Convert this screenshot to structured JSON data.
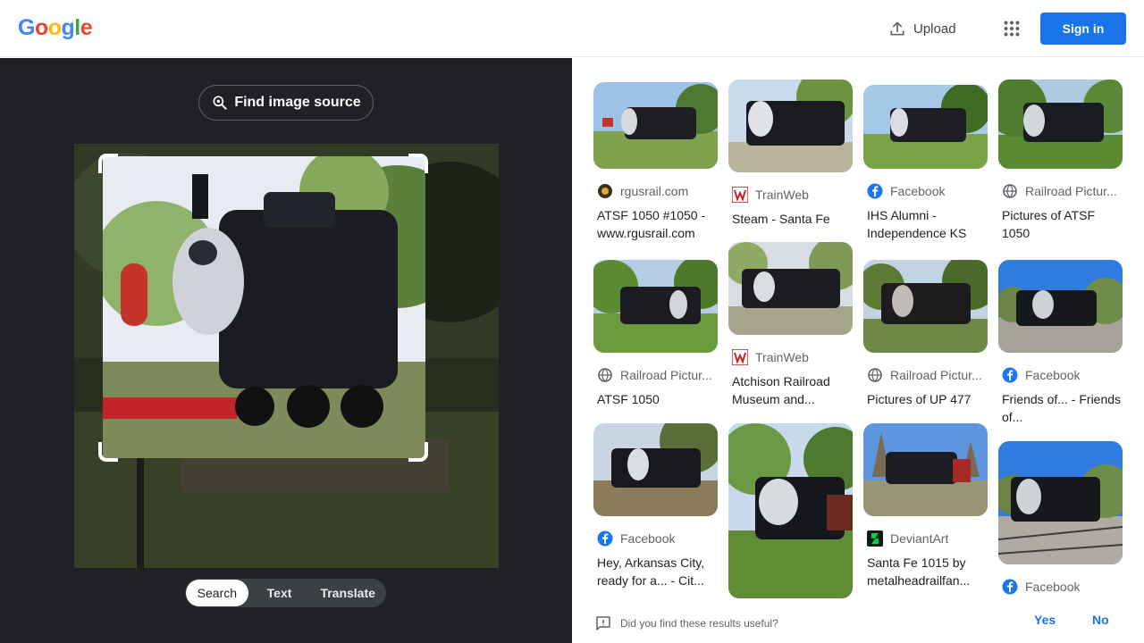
{
  "header": {
    "logo_letters": [
      {
        "ch": "G",
        "color": "#4285f4"
      },
      {
        "ch": "o",
        "color": "#ea4335"
      },
      {
        "ch": "o",
        "color": "#fbbc05"
      },
      {
        "ch": "g",
        "color": "#4285f4"
      },
      {
        "ch": "l",
        "color": "#34a853"
      },
      {
        "ch": "e",
        "color": "#ea4335"
      }
    ],
    "upload_label": "Upload",
    "apps_icon": "apps-grid-icon",
    "signin_label": "Sign in"
  },
  "lens": {
    "find_source_label": "Find image source",
    "modes": [
      {
        "label": "Search",
        "active": true
      },
      {
        "label": "Text",
        "active": false
      },
      {
        "label": "Translate",
        "active": false
      }
    ]
  },
  "results": [
    {
      "source": "rgusrail.com",
      "icon": "site-favicon",
      "title": "ATSF 1050 #1050 - www.rgusrail.com"
    },
    {
      "source": "TrainWeb",
      "icon": "trainweb-icon",
      "title": "Steam - Santa Fe"
    },
    {
      "source": "Facebook",
      "icon": "facebook-icon",
      "title": "IHS Alumni - Independence KS"
    },
    {
      "source": "Railroad Pictur...",
      "icon": "globe-icon",
      "title": "Pictures of ATSF 1050"
    },
    {
      "source": "Railroad Pictur...",
      "icon": "globe-icon",
      "title": "ATSF 1050"
    },
    {
      "source": "TrainWeb",
      "icon": "trainweb-icon",
      "title": "Atchison Railroad Museum and..."
    },
    {
      "source": "Railroad Pictur...",
      "icon": "globe-icon",
      "title": "Pictures of UP 477"
    },
    {
      "source": "Facebook",
      "icon": "facebook-icon",
      "title": "Friends of... - Friends of..."
    },
    {
      "source": "Facebook",
      "icon": "facebook-icon",
      "title": "Hey, Arkansas City, ready for a... - Cit..."
    },
    {
      "source": "",
      "icon": "",
      "title": ""
    },
    {
      "source": "DeviantArt",
      "icon": "deviantart-icon",
      "title": "Santa Fe 1015 by metalheadrailfan..."
    },
    {
      "source": "Facebook",
      "icon": "facebook-icon",
      "title": ""
    }
  ],
  "feedback": {
    "question": "Did you find these results useful?",
    "yes": "Yes",
    "no": "No"
  },
  "colors": {
    "accent": "#1a73e8",
    "dark_panel": "#202124",
    "facebook": "#1877f2",
    "trainweb": "#c5221f",
    "deviantart": "#05cc47"
  }
}
